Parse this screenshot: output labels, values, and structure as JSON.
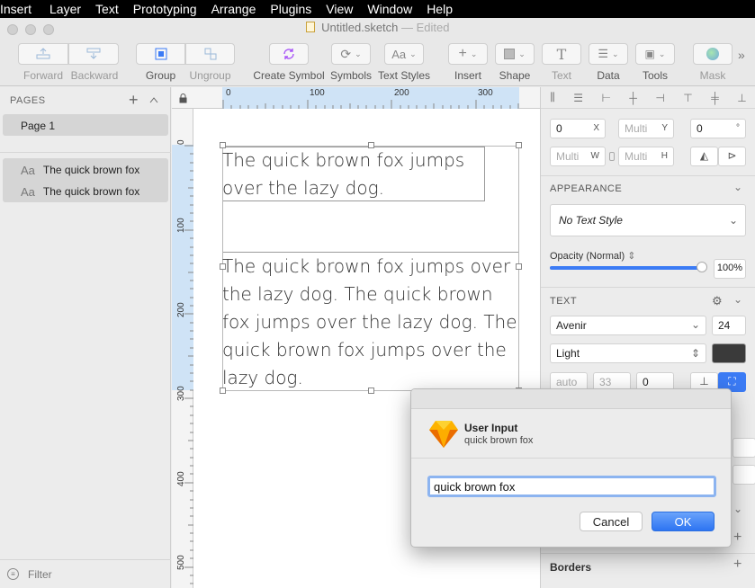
{
  "menubar": {
    "items": [
      "Insert",
      "Layer",
      "Text",
      "Prototyping",
      "Arrange",
      "Plugins",
      "View",
      "Window",
      "Help"
    ]
  },
  "window": {
    "title": "Untitled.sketch",
    "status": "— Edited"
  },
  "toolbar": {
    "forward": "Forward",
    "backward": "Backward",
    "group": "Group",
    "ungroup": "Ungroup",
    "create_symbol": "Create Symbol",
    "symbols": "Symbols",
    "text_styles": "Text Styles",
    "text_styles_icon": "Aa",
    "insert": "Insert",
    "shape": "Shape",
    "text": "Text",
    "data": "Data",
    "tools": "Tools",
    "mask": "Mask",
    "overflow": "»"
  },
  "sidebar": {
    "pages_header": "PAGES",
    "pages": [
      "Page 1"
    ],
    "layers": [
      {
        "icon": "Aa",
        "name": "The quick brown fox"
      },
      {
        "icon": "Aa",
        "name": "The quick brown fox"
      }
    ],
    "filter": "Filter"
  },
  "rulers": {
    "top": [
      "0",
      "100",
      "200",
      "300"
    ],
    "left": [
      "0",
      "100",
      "200",
      "300",
      "400",
      "500"
    ]
  },
  "canvas": {
    "text1": "The quick brown fox jumps\nover the lazy dog.",
    "text2": "The quick brown fox jumps over\nthe lazy dog. The quick brown\nfox jumps over the lazy dog. The\nquick brown fox jumps over the\nlazy dog."
  },
  "inspector": {
    "x": {
      "value": "0",
      "suffix": "X"
    },
    "y": {
      "value": "Multi",
      "suffix": "Y"
    },
    "rotation": {
      "value": "0",
      "suffix": "°"
    },
    "w": {
      "value": "Multi",
      "suffix": "W"
    },
    "h": {
      "value": "Multi",
      "suffix": "H"
    },
    "appearance_header": "APPEARANCE",
    "text_style": "No Text Style",
    "opacity_label": "Opacity (Normal)",
    "opacity_value": "100%",
    "opacity": 1.0,
    "text_header": "TEXT",
    "font_family": "Avenir",
    "font_size": "24",
    "font_weight": "Light",
    "text_color": "#3a3a3a",
    "line_height": "auto",
    "char_spacing": "33",
    "para_spacing": "0",
    "borders_header": "Borders"
  },
  "dialog": {
    "title": "User Input",
    "subtitle": "quick brown fox",
    "input_value": "quick brown fox",
    "cancel": "Cancel",
    "ok": "OK"
  },
  "colors": {
    "accent": "#3b7bf5",
    "selection": "#cfe3f6"
  }
}
